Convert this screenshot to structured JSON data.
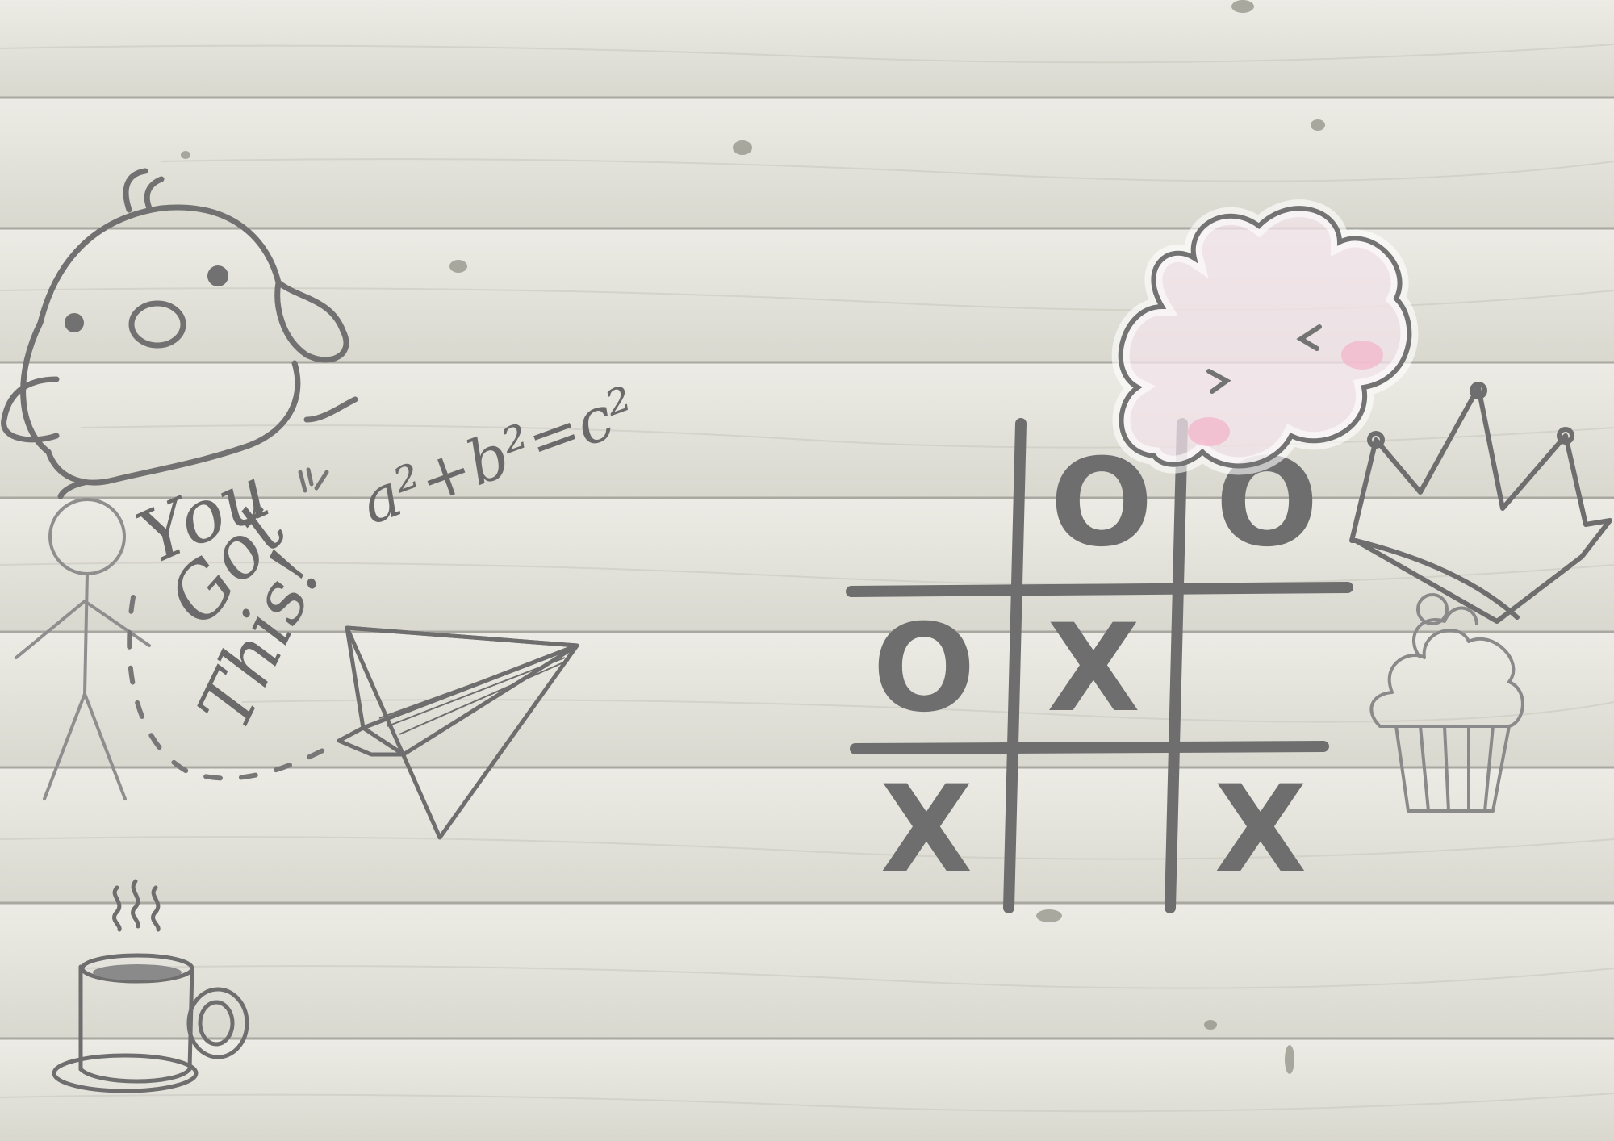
{
  "scene": {
    "background": "whitewashed-wood-planks",
    "ink_color": "#6e6e6e",
    "accent_pink": "#f2c6d6"
  },
  "doodles": {
    "formula": "a²+b²=c²",
    "motto_lines": [
      "You",
      "Got",
      "This!"
    ],
    "icons": [
      "doodle-face-icon",
      "stick-figure-icon",
      "paper-plane-icon",
      "coffee-cup-icon",
      "cloud-face-icon",
      "crown-icon",
      "cupcake-icon"
    ]
  },
  "tic_tac_toe": {
    "cells": [
      [
        "",
        "O",
        "O"
      ],
      [
        "O",
        "X",
        ""
      ],
      [
        "X",
        "",
        "X"
      ]
    ]
  }
}
